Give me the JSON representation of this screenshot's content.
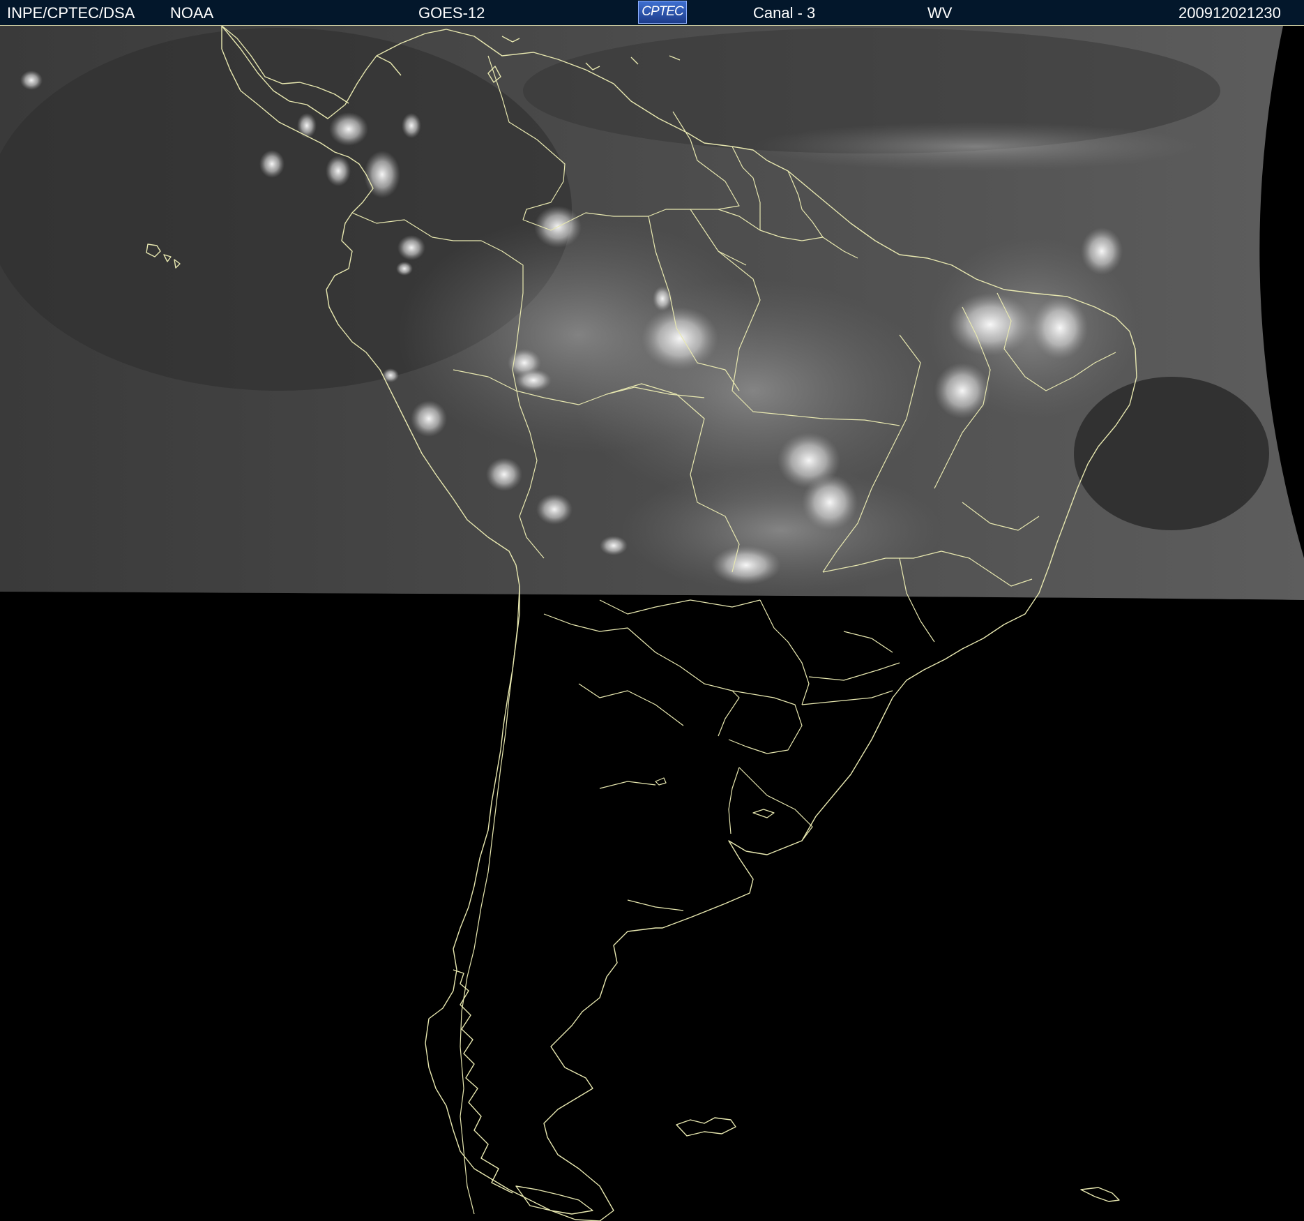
{
  "header": {
    "agency": "INPE/CPTEC/DSA",
    "source": "NOAA",
    "satellite": "GOES-12",
    "logo_text": "CPTEC",
    "channel": "Canal - 3",
    "band": "WV",
    "timestamp": "200912021230"
  },
  "colors": {
    "header_background": "#03172b",
    "coastline": "#e8e8b0",
    "background": "#000000"
  }
}
